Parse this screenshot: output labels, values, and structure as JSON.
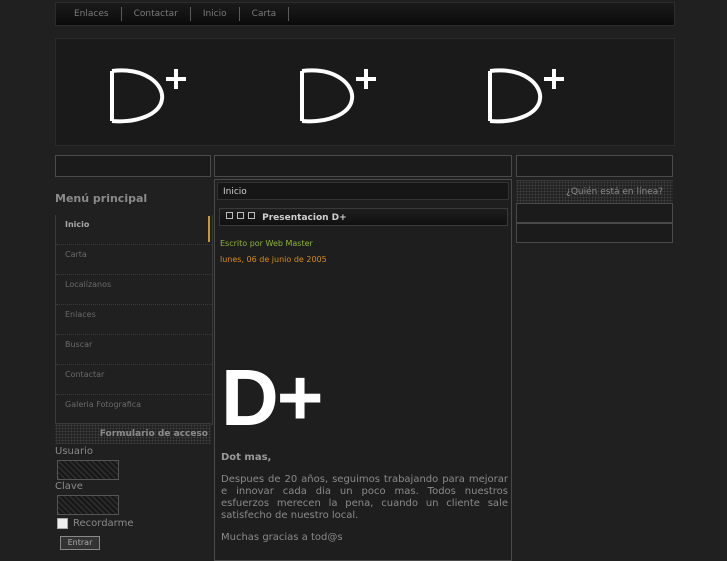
{
  "topnav": {
    "items": [
      "Enlaces",
      "Contactar",
      "Inicio",
      "Carta"
    ]
  },
  "header": {
    "logo_text": "D+"
  },
  "left": {
    "menu_title": "Menú principal",
    "menu": [
      "Inicio",
      "Carta",
      "Localízanos",
      "Enlaces",
      "Buscar",
      "Contactar",
      "Galeria Fotografica"
    ],
    "active_index": 0,
    "login": {
      "title": "Formulario de acceso",
      "user_label": "Usuario",
      "pass_label": "Clave",
      "remember_label": "Recordarme",
      "submit_label": "Entrar"
    }
  },
  "main": {
    "breadcrumb": "Inicio",
    "article_title": "Presentacion D+",
    "author": "Escrito por Web Master",
    "date": "lunes, 06 de junio de 2005",
    "big_logo": "D+",
    "lead": "Dot mas,",
    "body": "Despues de 20 años, seguimos trabajando para mejorar e innovar cada dia un poco mas. Todos nuestros esfuerzos merecen la pena, cuando un cliente sale satisfecho de nuestro local.",
    "thanks": "Muchas gracias a tod@s"
  },
  "right": {
    "who_title": "¿Quién está en línea?"
  },
  "colors": {
    "active_accent": "#c89a2a",
    "author": "#8fb33a",
    "date": "#d78b1e"
  }
}
